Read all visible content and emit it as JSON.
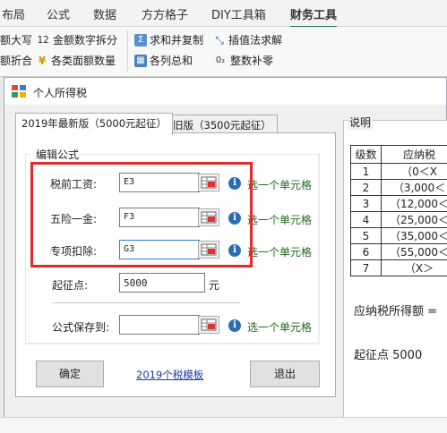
{
  "ribbon": {
    "tabs": [
      "布局",
      "公式",
      "数据",
      "方方格子",
      "DIY工具箱",
      "财务工具"
    ],
    "active_tab": "财务工具",
    "commands": [
      "额大写",
      "金额数字拆分",
      "求和并复制",
      "插值法求解",
      "额折合",
      "各类面额数量",
      "各列总和",
      "整数补零"
    ]
  },
  "dialog": {
    "title": "个人所得税",
    "tabs": [
      "2019年最新版（5000元起征）",
      "旧版（3500元起征）"
    ],
    "group_title": "编辑公式",
    "fields": [
      {
        "label": "税前工资:",
        "value": "E3",
        "hint": "选一个单元格"
      },
      {
        "label": "五险一金:",
        "value": "F3",
        "hint": "选一个单元格"
      },
      {
        "label": "专项扣除:",
        "value": "G3",
        "hint": "选一个单元格"
      }
    ],
    "threshold": {
      "label": "起征点:",
      "value": "5000",
      "unit": "元"
    },
    "save_to": {
      "label": "公式保存到:",
      "value": "",
      "hint": "选一个单元格"
    },
    "ok_label": "确定",
    "template_link": "2019个税模板",
    "exit_label": "退出",
    "info_glyph": "i"
  },
  "description": {
    "label": "说明",
    "headers": [
      "级数",
      "应纳税"
    ],
    "rows": [
      [
        "1",
        "（0＜X"
      ],
      [
        "2",
        "（3,000＜"
      ],
      [
        "3",
        "（12,000＜"
      ],
      [
        "4",
        "（25,000＜"
      ],
      [
        "5",
        "（35,000＜"
      ],
      [
        "6",
        "（55,000＜"
      ],
      [
        "7",
        "（X＞"
      ]
    ],
    "taxable_label": "应纳税所得额 =",
    "threshold_text": "起征点 5000"
  },
  "colors": {
    "accent": "#217346",
    "highlight": "#e22a2a",
    "hint": "#1e6b1e",
    "link": "#1a3aa8"
  }
}
